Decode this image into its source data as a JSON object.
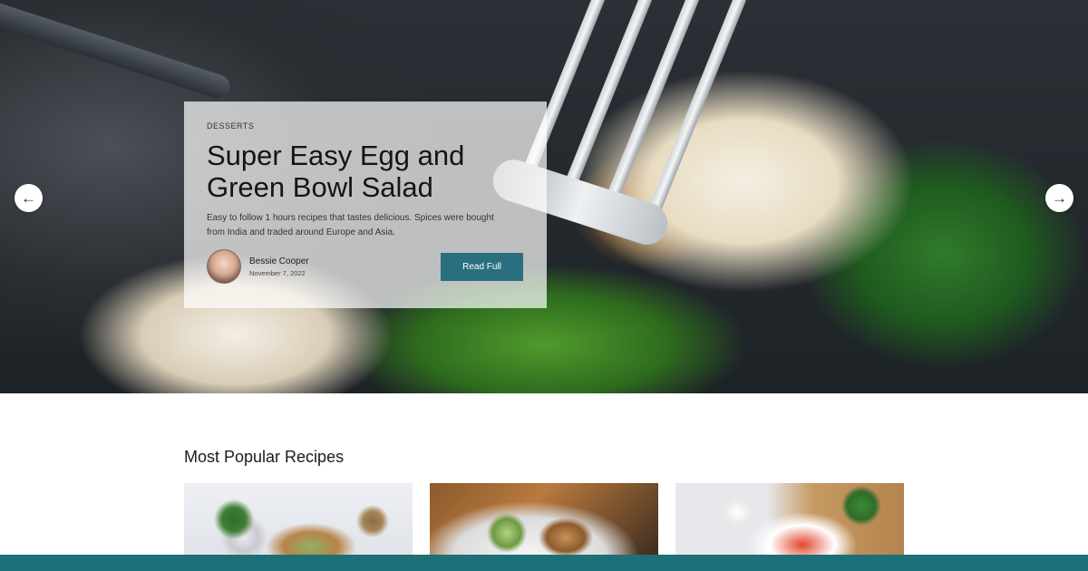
{
  "hero": {
    "category": "DESSERTS",
    "title": "Super Easy Egg and Green Bowl Salad",
    "description": "Easy to follow 1 hours recipes that tastes delicious. Spices were bought from India and traded around Europe and Asia.",
    "author": {
      "name": "Bessie Cooper",
      "date": "November 7, 2022"
    },
    "read_label": "Read Full",
    "prev_icon": "arrow-left-icon",
    "next_icon": "arrow-right-icon",
    "prev_glyph": "←",
    "next_glyph": "→"
  },
  "popular": {
    "title": "Most Popular Recipes"
  },
  "colors": {
    "accent": "#2a6f7e",
    "bottom_bar": "#1d6f78"
  }
}
